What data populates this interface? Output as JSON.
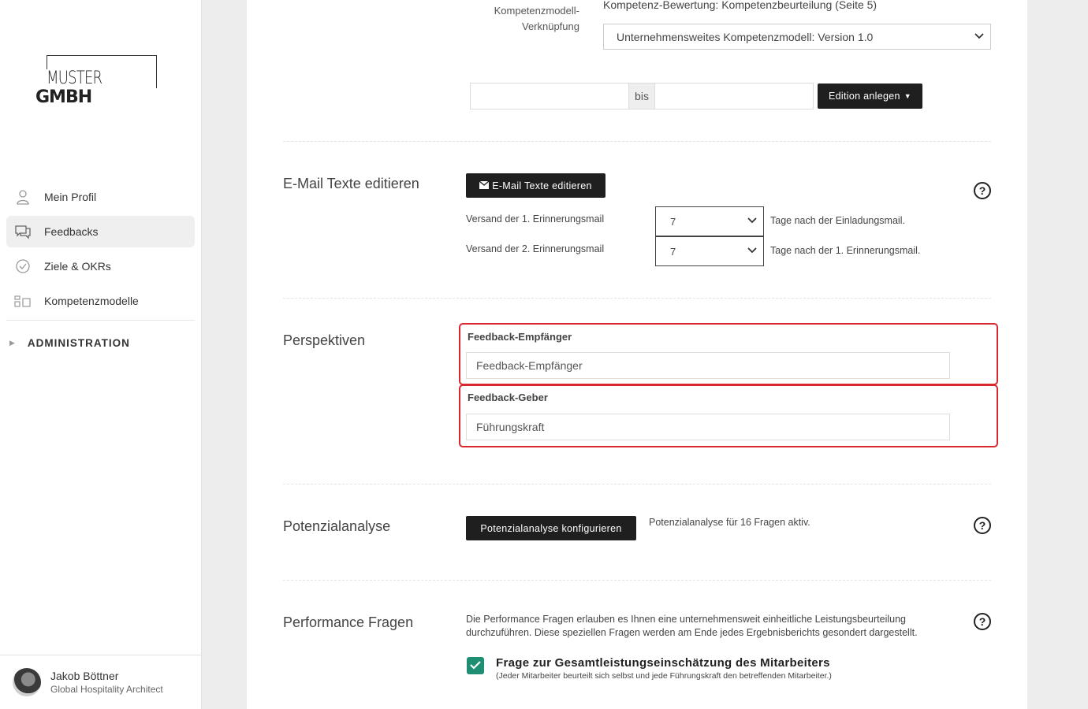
{
  "brand": {
    "logo_text_light": "MUSTER",
    "logo_text_bold": "GMBH"
  },
  "sidebar": {
    "items": [
      {
        "label": "Mein Profil",
        "icon": "user-icon",
        "active": false
      },
      {
        "label": "Feedbacks",
        "icon": "chat-icon",
        "active": true
      },
      {
        "label": "Ziele & OKRs",
        "icon": "check-circle-icon",
        "active": false
      },
      {
        "label": "Kompetenzmodelle",
        "icon": "model-icon",
        "active": false
      }
    ],
    "admin_label": "ADMINISTRATION"
  },
  "user": {
    "name": "Jakob Böttner",
    "role": "Global Hospitality Architect"
  },
  "competence": {
    "label_line1": "Kompetenzmodell-",
    "label_line2": "Verknüpfung",
    "heading": "Kompetenz-Bewertung: Kompetenzbeurteilung (Seite 5)",
    "select_value": "Unternehmensweites Kompetenzmodell: Version 1.0"
  },
  "edition": {
    "from_value": "",
    "bis_label": "bis",
    "to_value": "",
    "button_label": "Edition anlegen"
  },
  "email": {
    "title": "E-Mail Texte editieren",
    "button_label": "E-Mail Texte editieren",
    "reminder1_label": "Versand der 1. Erinnerungsmail",
    "reminder1_value": "7",
    "reminder1_suffix": "Tage nach der Einladungsmail.",
    "reminder2_label": "Versand der 2. Erinnerungsmail",
    "reminder2_value": "7",
    "reminder2_suffix": "Tage nach der 1. Erinnerungsmail."
  },
  "perspectives": {
    "title": "Perspektiven",
    "receiver_label": "Feedback-Empfänger",
    "receiver_value": "Feedback-Empfänger",
    "giver_label": "Feedback-Geber",
    "giver_value": "Führungskraft",
    "highlight_color": "#d9272e"
  },
  "potential": {
    "title": "Potenzialanalyse",
    "button_label": "Potenzialanalyse konfigurieren",
    "status": "Potenzialanalyse für 16 Fragen aktiv."
  },
  "performance": {
    "title": "Performance Fragen",
    "desc_line1": "Die Performance Fragen erlauben es Ihnen eine unternehmensweit einheitliche Leistungsbeurteilung",
    "desc_line2": "durchzuführen. Diese speziellen Fragen werden am Ende jedes Ergebnisberichts gesondert dargestellt.",
    "checkbox_label": "Frage zur Gesamtleistungseinschätzung des Mitarbeiters",
    "checkbox_hint": "(Jeder Mitarbeiter beurteilt sich selbst und jede Führungskraft den betreffenden Mitarbeiter.)",
    "checked": true,
    "accent_color": "#1e8f72"
  },
  "help_glyph": "?"
}
